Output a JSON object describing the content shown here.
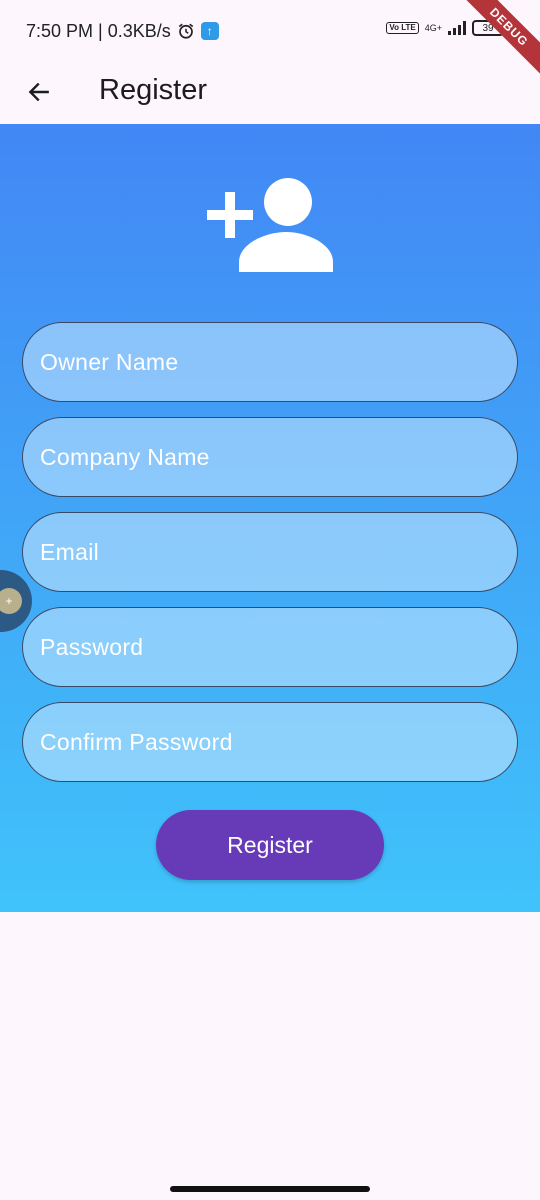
{
  "status_bar": {
    "time_text": "7:50 PM | 0.3KB/s",
    "alarm_icon": "alarm-clock-icon",
    "upload_icon": "upload-arrow-icon",
    "volte": "Vo LTE",
    "network": "4G+",
    "battery": "39"
  },
  "debug_banner": "DEBUG",
  "app_bar": {
    "back_icon": "arrow-back-icon",
    "title": "Register"
  },
  "hero": {
    "icon": "person-add-icon"
  },
  "form": {
    "fields": [
      {
        "label": "Owner Name"
      },
      {
        "label": "Company Name"
      },
      {
        "label": "Email"
      },
      {
        "label": "Password"
      },
      {
        "label": "Confirm Password"
      }
    ],
    "submit_label": "Register"
  },
  "colors": {
    "gradient_top": "#4287f5",
    "gradient_bottom": "#40c3fb",
    "button": "#673ab7",
    "background": "#fdf6fd"
  }
}
